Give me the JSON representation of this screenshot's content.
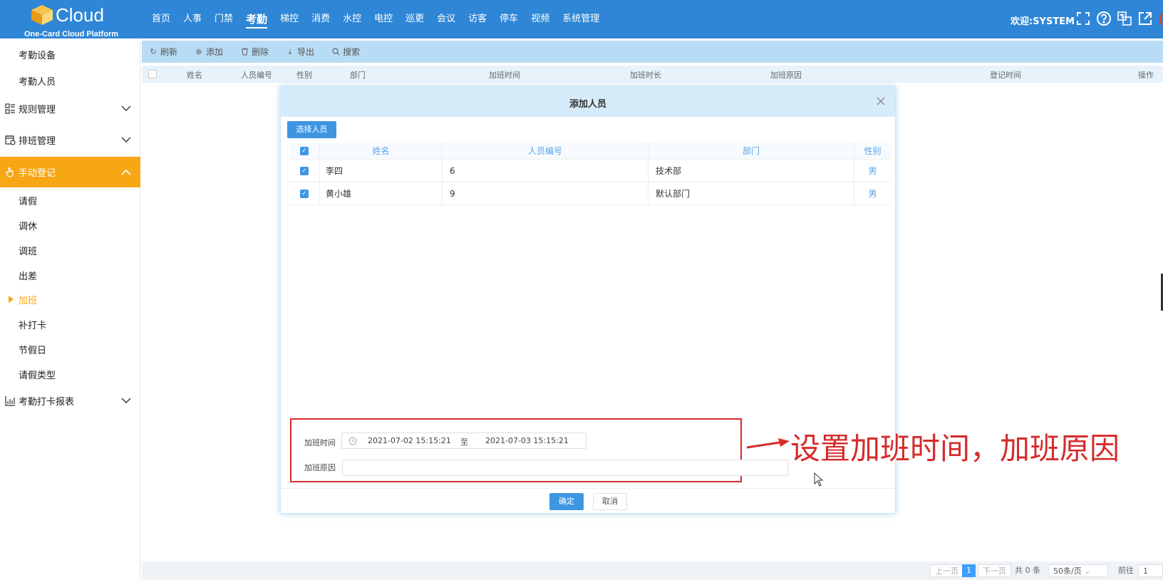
{
  "header": {
    "logo_text": "Cloud",
    "logo_subtitle": "One-Card Cloud Platform",
    "nav": [
      "首页",
      "人事",
      "门禁",
      "考勤",
      "梯控",
      "消费",
      "水控",
      "电控",
      "巡更",
      "会议",
      "访客",
      "停车",
      "视频",
      "系统管理"
    ],
    "active_nav": "考勤",
    "welcome": "欢迎:SYSTEM",
    "icons": [
      "fullscreen-icon",
      "help-icon",
      "language-icon",
      "external-link-icon",
      "power-icon"
    ]
  },
  "sidebar": {
    "top_items": [
      "考勤设备",
      "考勤人员"
    ],
    "groups": [
      {
        "label": "规则管理",
        "icon": "rules-icon"
      },
      {
        "label": "排班管理",
        "icon": "schedule-icon"
      },
      {
        "label": "手动登记",
        "icon": "hand-icon"
      },
      {
        "label": "考勤打卡报表",
        "icon": "report-chart-icon"
      }
    ],
    "sub_items": [
      "请假",
      "调休",
      "调班",
      "出差",
      "加班",
      "补打卡",
      "节假日",
      "请假类型"
    ],
    "active_item": "加班"
  },
  "toolbar": {
    "refresh": "刷新",
    "add": "添加",
    "delete": "删除",
    "export": "导出",
    "search": "搜索"
  },
  "table": {
    "columns": [
      "姓名",
      "人员编号",
      "性别",
      "部门",
      "加班时间",
      "加班时长",
      "加班原因",
      "登记时间",
      "操作"
    ]
  },
  "footer": {
    "prev": "上一页",
    "current_page": "1",
    "next": "下一页",
    "total": "共 0 条",
    "page_size": "50条/页",
    "goto_label": "前往",
    "goto_value": "1"
  },
  "modal": {
    "title": "添加人员",
    "select_button": "选择人员",
    "columns": [
      "姓名",
      "人员编号",
      "部门",
      "性别"
    ],
    "rows": [
      {
        "name": "李四",
        "id": "6",
        "dept": "技术部",
        "gender": "男"
      },
      {
        "name": "黄小雄",
        "id": "9",
        "dept": "默认部门",
        "gender": "男"
      }
    ],
    "overtime_time_label": "加班时间",
    "start_time": "2021-07-02 15:15:21",
    "range_separator": "至",
    "end_time": "2021-07-03 15:15:21",
    "reason_label": "加班原因",
    "reason_value": "",
    "ok": "确定",
    "cancel": "取消"
  },
  "annotation": {
    "text": "设置加班时间，加班原因",
    "color": "#d62b2b"
  },
  "colors": {
    "header_bg": "#2f86d6",
    "accent_orange": "#f7a614",
    "primary_blue": "#3e96e3"
  }
}
